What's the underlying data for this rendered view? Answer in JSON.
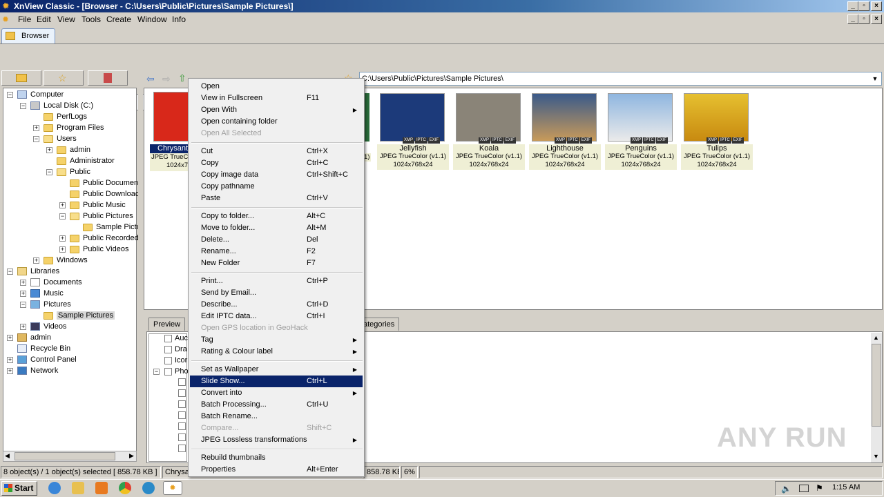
{
  "window": {
    "title": "XnView Classic - [Browser - C:\\Users\\Public\\Pictures\\Sample Pictures\\]"
  },
  "menubar": [
    "File",
    "Edit",
    "View",
    "Tools",
    "Create",
    "Window",
    "Info"
  ],
  "tabs": {
    "browser": "Browser"
  },
  "address": {
    "value": "C:\\Users\\Public\\Pictures\\Sample Pictures\\"
  },
  "tree": {
    "computer": "Computer",
    "local_disk": "Local Disk (C:)",
    "perflogs": "PerfLogs",
    "program_files": "Program Files",
    "users": "Users",
    "admin": "admin",
    "administrator": "Administrator",
    "public": "Public",
    "public_documents": "Public Documen",
    "public_downloads": "Public Downloac",
    "public_music": "Public Music",
    "public_pictures": "Public Pictures",
    "sample_pictures_short": "Sample Pictu",
    "public_recorded": "Public Recorded",
    "public_videos": "Public Videos",
    "windows": "Windows",
    "libraries": "Libraries",
    "documents": "Documents",
    "music": "Music",
    "pictures": "Pictures",
    "sample_pictures": "Sample Pictures",
    "videos": "Videos",
    "admin_root": "admin",
    "recycle_bin": "Recycle Bin",
    "control_panel": "Control Panel",
    "network": "Network"
  },
  "thumbnails": [
    {
      "name": "Chrysant",
      "type": "JPEG TrueC",
      "size": "1024x7",
      "color": "#d8281a"
    },
    {
      "name": "Jellyfish",
      "type": "JPEG TrueColor (v1.1)",
      "size": "1024x768x24",
      "color": "#1c3a7a"
    },
    {
      "name": "Koala",
      "type": "JPEG TrueColor (v1.1)",
      "size": "1024x768x24",
      "color": "#8a8478"
    },
    {
      "name": "Lighthouse",
      "type": "JPEG TrueColor (v1.1)",
      "size": "1024x768x24",
      "color": "#6b7f9a"
    },
    {
      "name": "Penguins",
      "type": "JPEG TrueColor (v1.1)",
      "size": "1024x768x24",
      "color": "#5f8fc6"
    },
    {
      "name": "Tulips",
      "type": "JPEG TrueColor (v1.1)",
      "size": "1024x768x24",
      "color": "#e6b81e"
    }
  ],
  "partial_thumb_type": "1)",
  "badges": {
    "xmp": "XMP",
    "iptc": "IPTC",
    "exif": "EXIF"
  },
  "bottom_tabs": {
    "preview": "Preview",
    "categories": "ategories"
  },
  "categories": [
    "Auc",
    "Dra",
    "Icor",
    "Pho"
  ],
  "context_menu": {
    "items": [
      {
        "label": "Open",
        "shortcut": ""
      },
      {
        "label": "View in Fullscreen",
        "shortcut": "F11"
      },
      {
        "label": "Open With",
        "shortcut": "",
        "submenu": true
      },
      {
        "label": "Open containing folder",
        "shortcut": ""
      },
      {
        "label": "Open All Selected",
        "shortcut": "",
        "disabled": true
      },
      {
        "label": "Cut",
        "shortcut": "Ctrl+X"
      },
      {
        "label": "Copy",
        "shortcut": "Ctrl+C"
      },
      {
        "label": "Copy image data",
        "shortcut": "Ctrl+Shift+C"
      },
      {
        "label": "Copy pathname",
        "shortcut": ""
      },
      {
        "label": "Paste",
        "shortcut": "Ctrl+V"
      },
      {
        "label": "Copy to folder...",
        "shortcut": "Alt+C"
      },
      {
        "label": "Move to folder...",
        "shortcut": "Alt+M"
      },
      {
        "label": "Delete...",
        "shortcut": "Del"
      },
      {
        "label": "Rename...",
        "shortcut": "F2"
      },
      {
        "label": "New Folder",
        "shortcut": "F7"
      },
      {
        "label": "Print...",
        "shortcut": "Ctrl+P"
      },
      {
        "label": "Send by Email...",
        "shortcut": ""
      },
      {
        "label": "Describe...",
        "shortcut": "Ctrl+D"
      },
      {
        "label": "Edit IPTC data...",
        "shortcut": "Ctrl+I"
      },
      {
        "label": "Open GPS location in GeoHack",
        "shortcut": "",
        "disabled": true
      },
      {
        "label": "Tag",
        "shortcut": "",
        "submenu": true
      },
      {
        "label": "Rating & Colour label",
        "shortcut": "",
        "submenu": true
      },
      {
        "label": "Set as Wallpaper",
        "shortcut": "",
        "submenu": true
      },
      {
        "label": "Slide Show...",
        "shortcut": "Ctrl+L",
        "highlight": true
      },
      {
        "label": "Convert into",
        "shortcut": "",
        "submenu": true
      },
      {
        "label": "Batch Processing...",
        "shortcut": "Ctrl+U"
      },
      {
        "label": "Batch Rename...",
        "shortcut": ""
      },
      {
        "label": "Compare...",
        "shortcut": "Shift+C",
        "disabled": true
      },
      {
        "label": "JPEG Lossless transformations",
        "shortcut": "",
        "submenu": true
      },
      {
        "label": "Rebuild thumbnails",
        "shortcut": ""
      },
      {
        "label": "Properties",
        "shortcut": "Alt+Enter"
      }
    ]
  },
  "status": {
    "objects": "8 object(s) / 1 object(s) selected  [ 858.78 KB ]",
    "file": "Chrysa",
    "size": "858.78 KB",
    "zoom": "6%"
  },
  "taskbar": {
    "start": "Start",
    "clock": "1:15 AM"
  },
  "watermark": "ANY RUN"
}
